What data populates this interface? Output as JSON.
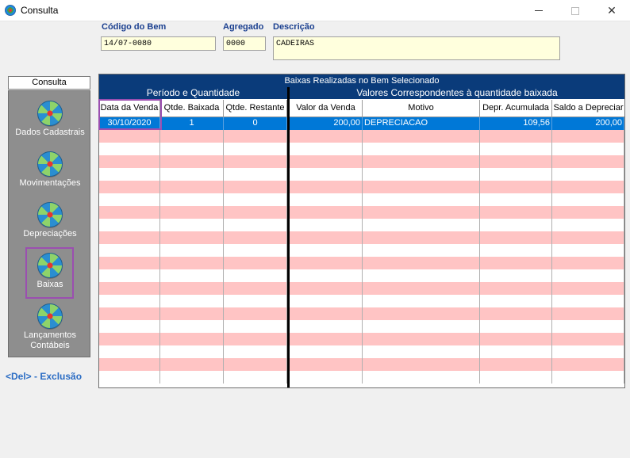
{
  "window": {
    "title": "Consulta",
    "minimize": "–",
    "maximize": "□",
    "close": "✕"
  },
  "fields": {
    "codigo": {
      "label": "Código do Bem",
      "value": "14/07-0080"
    },
    "agregado": {
      "label": "Agregado",
      "value": "0000"
    },
    "descricao": {
      "label": "Descrição",
      "value": "CADEIRAS"
    }
  },
  "sidebar": {
    "title": "Consulta",
    "items": [
      {
        "label": "Dados Cadastrais",
        "icon": "globe-icon"
      },
      {
        "label": "Movimentações",
        "icon": "globe-icon"
      },
      {
        "label": "Depreciações",
        "icon": "globe-icon"
      },
      {
        "label": "Baixas",
        "icon": "globe-icon"
      },
      {
        "label": "Lançamentos Contábeis",
        "icon": "globe-icon"
      }
    ],
    "selected": "Baixas"
  },
  "shortcut": "<Del> - Exclusão",
  "grid": {
    "title": "Baixas Realizadas no Bem Selecionado",
    "group1": "Período e Quantidade",
    "group2": "Valores Correspondentes à quantidade baixada",
    "columns": [
      "Data da Venda",
      "Qtde. Baixada",
      "Qtde. Restante",
      "Valor da Venda",
      "Motivo",
      "Depr. Acumulada",
      "Saldo a Depreciar"
    ],
    "rows": [
      [
        "30/10/2020",
        "1",
        "0",
        "200,00",
        "DEPRECIACAO",
        "109,56",
        "200,00"
      ]
    ]
  },
  "colors": {
    "header_bg": "#0a3b7a",
    "row_alt": "#ffc4c4",
    "selected_row": "#0078d7",
    "highlight": "#9b4fb0",
    "label_blue": "#1a3f8f",
    "input_bg": "#ffffdd"
  }
}
